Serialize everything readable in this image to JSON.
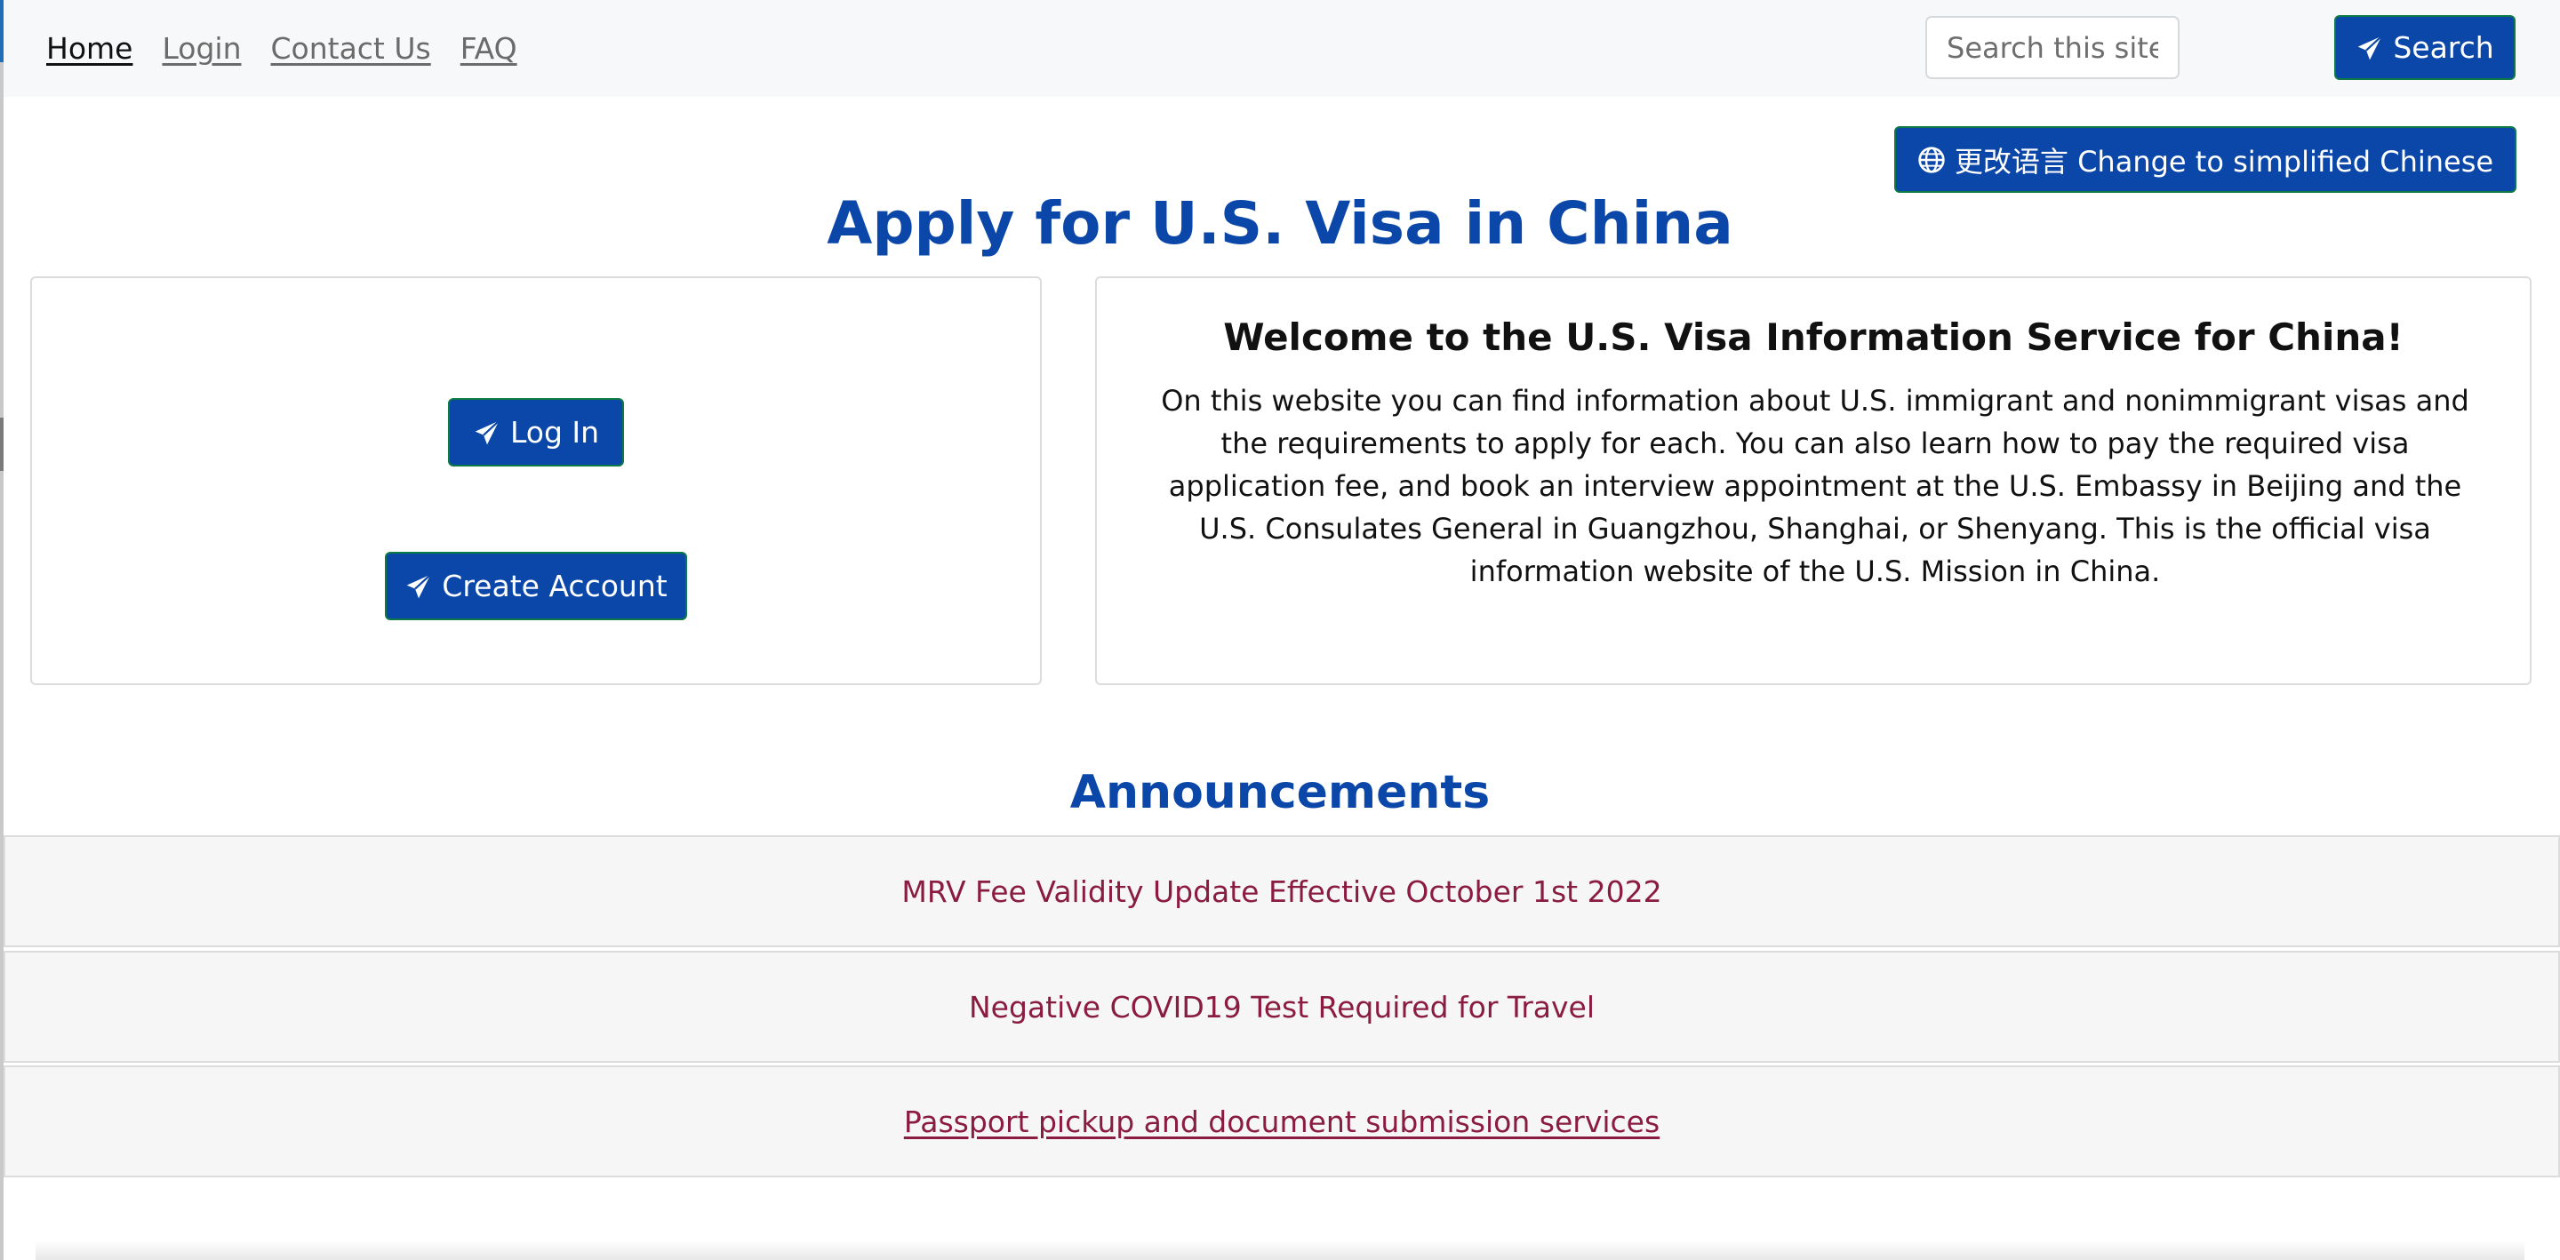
{
  "nav": {
    "home": "Home",
    "login": "Login",
    "contact": "Contact Us",
    "faq": "FAQ"
  },
  "search": {
    "placeholder": "Search this site on Bing",
    "button_label": "Search"
  },
  "language_button": "更改语言 Change to simplified Chinese",
  "page_title": "Apply for U.S. Visa in China",
  "auth": {
    "login_label": "Log In",
    "create_label": "Create Account"
  },
  "welcome": {
    "title": "Welcome to the U.S. Visa Information Service for China!",
    "body": "On this website you can find information about U.S. immigrant and nonimmigrant visas and the requirements to apply for each. You can also learn how to pay the required visa application fee, and book an interview appointment at the U.S. Embassy in Beijing and the U.S. Consulates General in Guangzhou, Shanghai, or Shenyang. This is the official visa information website of the U.S. Mission in China."
  },
  "announcements": {
    "title": "Announcements",
    "items": [
      "MRV Fee Validity Update Effective October 1st 2022",
      "Negative COVID19 Test Required for Travel",
      "Passport pickup and document submission services"
    ]
  },
  "icons": {
    "send": "paper-plane-icon",
    "language": "globe-icon"
  },
  "colors": {
    "primary": "#0b47a8",
    "button_border": "#0d7a45",
    "announcement_text": "#8a1c40"
  }
}
